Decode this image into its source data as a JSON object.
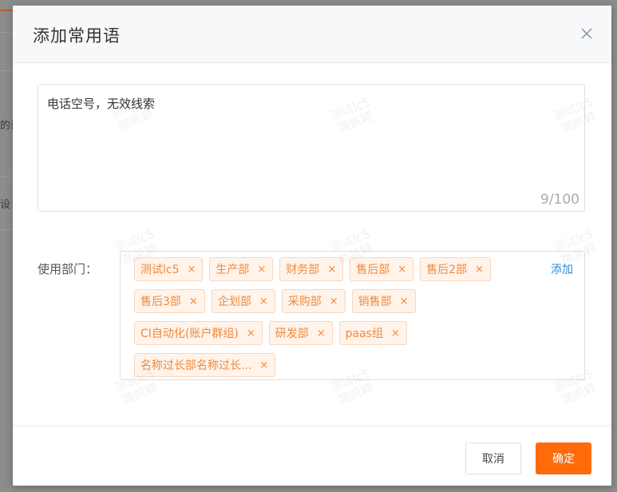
{
  "background": {
    "side_text_1": "的设",
    "side_text_2": "设"
  },
  "dialog": {
    "title": "添加常用语",
    "content": "电话空号，无效线索",
    "counter": "9/100",
    "dept_label": "使用部门：",
    "add_label": "添加",
    "tag_rows": [
      [
        "测试lc5",
        "生产部",
        "财务部",
        "售后部",
        "售后2部"
      ],
      [
        "售后3部",
        "企划部",
        "采购部",
        "销售部"
      ],
      [
        "CI自动化(账户群组)",
        "研发部",
        "paas组"
      ],
      [
        "名称过长部名称过长..."
      ]
    ],
    "cancel_label": "取消",
    "ok_label": "确定"
  },
  "watermark": {
    "line1": "测试lc5",
    "line2": "简凯颖"
  },
  "colors": {
    "primary": "#ff6a0a",
    "tag_text": "#ef8a3c",
    "link": "#2a8cdb"
  }
}
